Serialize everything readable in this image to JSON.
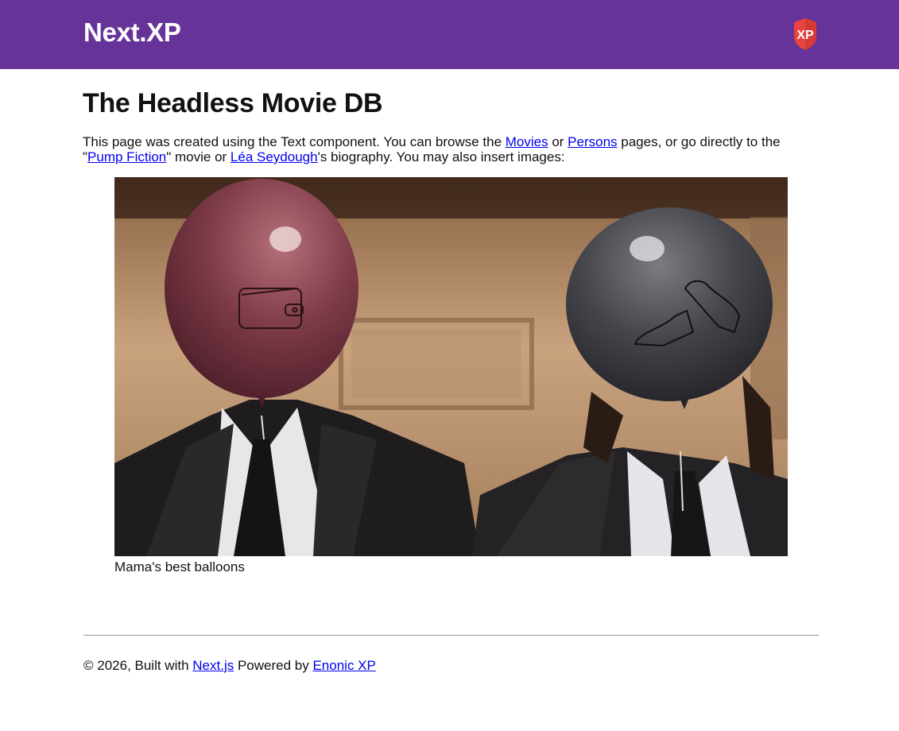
{
  "header": {
    "brand": "Next.XP",
    "logo_text": "XP",
    "background": "#663399",
    "logo_color": "#e8433e"
  },
  "main": {
    "title": "The Headless Movie DB",
    "intro": {
      "part1": "This page was created using the Text component. You can browse the ",
      "movies_link": "Movies",
      "part2": " or ",
      "persons_link": "Persons",
      "part3": " pages, or go directly to the \"",
      "movie_link": "Pump Fiction",
      "part4": "\" movie or ",
      "person_link": "Léa Seydough",
      "part5": "'s biography. You may also insert images:"
    },
    "figure": {
      "caption": "Mama's best balloons"
    }
  },
  "footer": {
    "copyright": "© 2026, Built with ",
    "nextjs_link": "Next.js",
    "powered_by": " Powered by ",
    "enonic_link": "Enonic XP"
  },
  "colors": {
    "link": "#0000ee",
    "text": "#111111"
  }
}
